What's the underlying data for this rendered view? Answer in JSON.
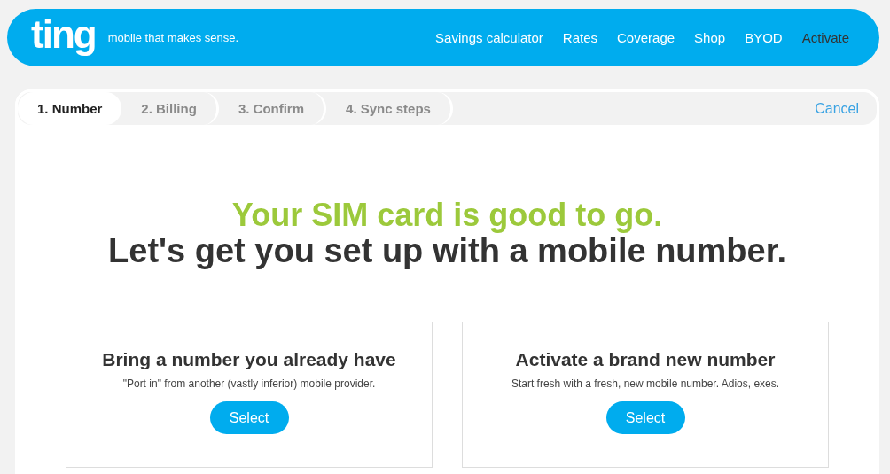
{
  "header": {
    "logo": "ting",
    "tagline": "mobile that makes sense.",
    "nav": [
      {
        "label": "Savings calculator",
        "selected": false
      },
      {
        "label": "Rates",
        "selected": false
      },
      {
        "label": "Coverage",
        "selected": false
      },
      {
        "label": "Shop",
        "selected": false
      },
      {
        "label": "BYOD",
        "selected": false
      },
      {
        "label": "Activate",
        "selected": true
      }
    ]
  },
  "steps": [
    {
      "label": "1. Number",
      "selected": true
    },
    {
      "label": "2. Billing",
      "selected": false
    },
    {
      "label": "3. Confirm",
      "selected": false
    },
    {
      "label": "4. Sync steps",
      "selected": false
    }
  ],
  "cancel": "Cancel",
  "headline": "Your SIM card is good to go.",
  "subheadline": "Let's get you set up with a mobile number.",
  "options": [
    {
      "title": "Bring a number you already have",
      "description": "\"Port in\" from another (vastly inferior) mobile provider.",
      "button": "Select"
    },
    {
      "title": "Activate a brand new number",
      "description": "Start fresh with a fresh, new mobile number. Adios, exes.",
      "button": "Select"
    }
  ]
}
